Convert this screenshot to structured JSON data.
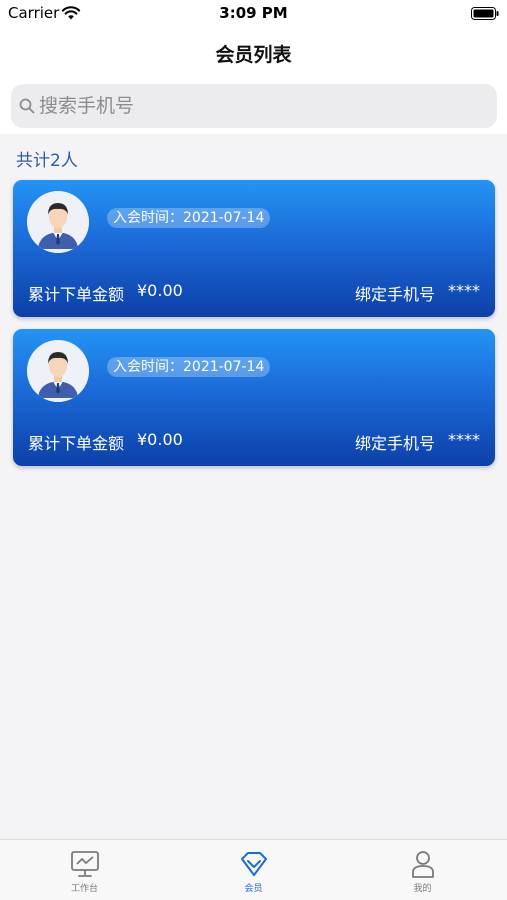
{
  "status_bar": {
    "carrier": "Carrier",
    "time": "3:09 PM"
  },
  "nav": {
    "title": "会员列表"
  },
  "search": {
    "placeholder": "搜索手机号",
    "value": ""
  },
  "summary": {
    "count_text": "共计2人"
  },
  "members": [
    {
      "join_text": "入会时间：2021-07-14",
      "total_label": "累计下单金额",
      "total_value": "¥0.00",
      "phone_label": "绑定手机号",
      "phone_value": "****"
    },
    {
      "join_text": "入会时间：2021-07-14",
      "total_label": "累计下单金额",
      "total_value": "¥0.00",
      "phone_label": "绑定手机号",
      "phone_value": "****"
    }
  ],
  "tabs": [
    {
      "label": "工作台",
      "icon": "monitor-icon",
      "active": false
    },
    {
      "label": "会员",
      "icon": "diamond-icon",
      "active": true
    },
    {
      "label": "我的",
      "icon": "person-icon",
      "active": false
    }
  ],
  "colors": {
    "accent": "#1b6ad8",
    "card_top": "#2394f4",
    "card_bottom": "#0d40a8",
    "count_text": "#2d5aa8"
  }
}
